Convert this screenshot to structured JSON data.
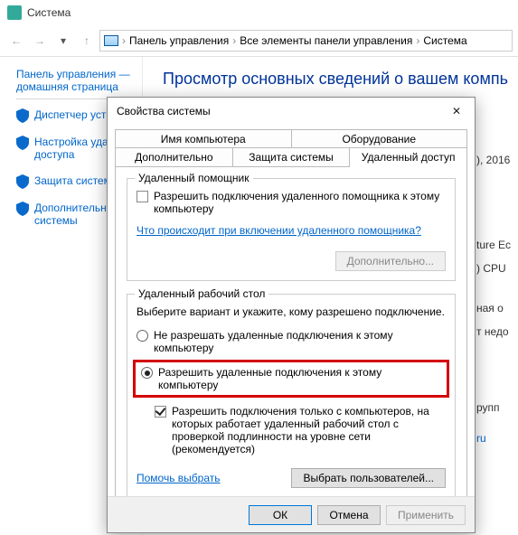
{
  "window": {
    "title": "Система"
  },
  "breadcrumbs": {
    "a": "Панель управления",
    "b": "Все элементы панели управления",
    "c": "Система"
  },
  "sidebar": {
    "home1": "Панель управления —",
    "home2": "домашняя страница",
    "items": [
      "Диспетчер устр",
      "Настройка уда\nдоступа",
      "Защита систем",
      "Дополнительнь\nсистемы"
    ]
  },
  "main": {
    "heading": "Просмотр основных сведений о вашем компь"
  },
  "right": {
    "l1": "), 2016",
    "l2": "ture Ec",
    "l3": ") CPU",
    "l4": "ная о",
    "l5": "т недо",
    "l6": "рупп",
    "l7": "ru"
  },
  "dialog": {
    "title": "Свойства системы",
    "tabs": {
      "r1a": "Имя компьютера",
      "r1b": "Оборудование",
      "r2a": "Дополнительно",
      "r2b": "Защита системы",
      "r2c": "Удаленный доступ"
    },
    "g1": {
      "title": "Удаленный помощник",
      "chk": "Разрешить подключения удаленного помощника к этому компьютеру",
      "link": "Что происходит при включении удаленного помощника?",
      "btn": "Дополнительно..."
    },
    "g2": {
      "title": "Удаленный рабочий стол",
      "desc": "Выберите вариант и укажите, кому разрешено подключение.",
      "opt1": "Не разрешать удаленные подключения к этому компьютеру",
      "opt2": "Разрешить удаленные подключения к этому компьютеру",
      "sub": "Разрешить подключения только с компьютеров, на которых работает удаленный рабочий стол с проверкой подлинности на уровне сети (рекомендуется)",
      "help": "Помочь выбрать",
      "users": "Выбрать пользователей..."
    },
    "buttons": {
      "ok": "ОК",
      "cancel": "Отмена",
      "apply": "Применить"
    }
  }
}
